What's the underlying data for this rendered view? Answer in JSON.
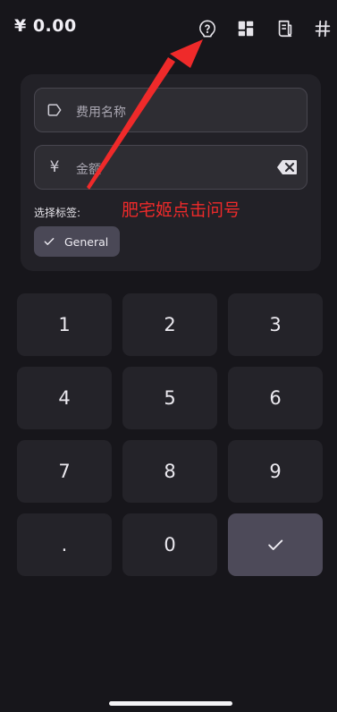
{
  "header": {
    "total": "¥ 0.00",
    "icons": [
      "help-circle-icon",
      "dashboard-icon",
      "receipt-icon",
      "hash-icon"
    ]
  },
  "form": {
    "name_placeholder": "费用名称",
    "currency_symbol": "¥",
    "amount_placeholder": "金额",
    "tag_label": "选择标签:",
    "tag_chip": "General"
  },
  "annotation": {
    "text": "肥宅姬点击问号",
    "color": "#ef2a2a"
  },
  "keypad": {
    "keys": [
      "1",
      "2",
      "3",
      "4",
      "5",
      "6",
      "7",
      "8",
      "9",
      ".",
      "0"
    ]
  },
  "colors": {
    "background": "#17161b",
    "card": "#222127",
    "key": "#242329",
    "confirm_key": "#4d4a59",
    "chip": "#4a4856"
  }
}
